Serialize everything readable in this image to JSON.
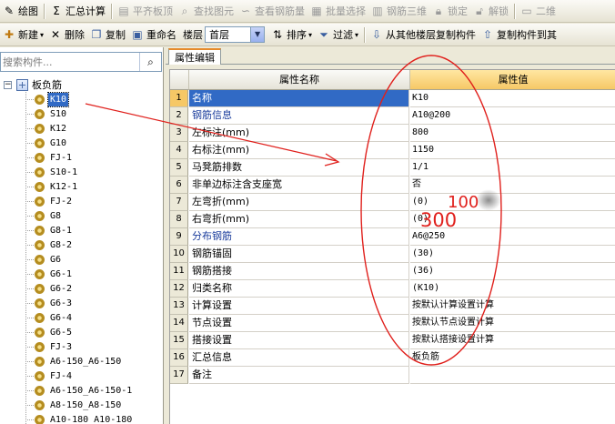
{
  "toolbar1": {
    "items": [
      {
        "label": "绘图",
        "icon": "pencil-icon",
        "enabled": true
      },
      {
        "label": "汇总计算",
        "icon": "sigma-icon",
        "enabled": true
      },
      {
        "label": "平齐板顶",
        "icon": "align-top-icon",
        "enabled": false
      },
      {
        "label": "查找图元",
        "icon": "find-icon",
        "enabled": false
      },
      {
        "label": "查看钢筋量",
        "icon": "rebar-view-icon",
        "enabled": false
      },
      {
        "label": "批量选择",
        "icon": "batch-select-icon",
        "enabled": false
      },
      {
        "label": "钢筋三维",
        "icon": "rebar-3d-icon",
        "enabled": false
      },
      {
        "label": "锁定",
        "icon": "lock-icon",
        "enabled": false
      },
      {
        "label": "解锁",
        "icon": "unlock-icon",
        "enabled": false
      },
      {
        "label": "二维",
        "icon": "2d-icon",
        "enabled": false
      }
    ]
  },
  "toolbar2": {
    "new_label": "新建",
    "delete_label": "删除",
    "copy_label": "复制",
    "rename_label": "重命名",
    "floor_label": "楼层",
    "floor_value": "首层",
    "sort_label": "排序",
    "filter_label": "过滤",
    "copy_from_floor_label": "从其他楼层复制构件",
    "copy_to_label": "复制构件到其"
  },
  "search": {
    "placeholder": "搜索构件..."
  },
  "tree": {
    "root_label": "板负筋",
    "items": [
      "K10",
      "S10",
      "K12",
      "G10",
      "FJ-1",
      "S10-1",
      "K12-1",
      "FJ-2",
      "G8",
      "G8-1",
      "G8-2",
      "G6",
      "G6-1",
      "G6-2",
      "G6-3",
      "G6-4",
      "G6-5",
      "FJ-3",
      "A6-150_A6-150",
      "FJ-4",
      "A6-150_A6-150-1",
      "A8-150_A8-150",
      "A10-180_A10-180"
    ],
    "selected_index": 0
  },
  "tab": {
    "label": "属性编辑"
  },
  "grid": {
    "header_name": "属性名称",
    "header_value": "属性值",
    "rows": [
      {
        "num": "1",
        "name": "名称",
        "value": "K10"
      },
      {
        "num": "2",
        "name": "钢筋信息",
        "value": "A10@200"
      },
      {
        "num": "3",
        "name": "左标注(mm)",
        "value": "800"
      },
      {
        "num": "4",
        "name": "右标注(mm)",
        "value": "1150"
      },
      {
        "num": "5",
        "name": "马凳筋排数",
        "value": "1/1"
      },
      {
        "num": "6",
        "name": "非单边标注含支座宽",
        "value": "否"
      },
      {
        "num": "7",
        "name": "左弯折(mm)",
        "value": "(0)"
      },
      {
        "num": "8",
        "name": "右弯折(mm)",
        "value": "(0)"
      },
      {
        "num": "9",
        "name": "分布钢筋",
        "value": "A6@250"
      },
      {
        "num": "10",
        "name": "钢筋锚固",
        "value": "(30)"
      },
      {
        "num": "11",
        "name": "钢筋搭接",
        "value": "(36)"
      },
      {
        "num": "12",
        "name": "归类名称",
        "value": "(K10)"
      },
      {
        "num": "13",
        "name": "计算设置",
        "value": "按默认计算设置计算"
      },
      {
        "num": "14",
        "name": "节点设置",
        "value": "按默认节点设置计算"
      },
      {
        "num": "15",
        "name": "搭接设置",
        "value": "按默认搭接设置计算"
      },
      {
        "num": "16",
        "name": "汇总信息",
        "value": "板负筋"
      },
      {
        "num": "17",
        "name": "备注",
        "value": ""
      }
    ],
    "blue_rows": [
      1,
      8
    ],
    "selected_row": 0
  },
  "annotations": {
    "text_100": "100",
    "text_300": "300",
    "color": "#e0201c"
  }
}
